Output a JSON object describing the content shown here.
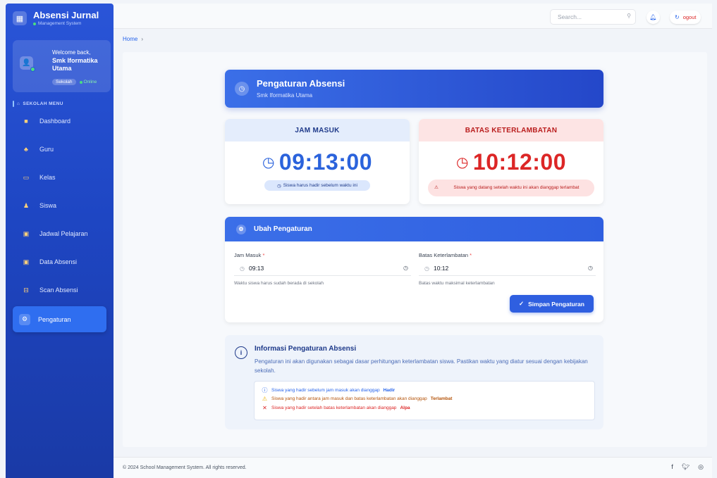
{
  "brand": {
    "title": "Absensi Jurnal",
    "subtitle": "Management System",
    "logo_icon": "building-icon"
  },
  "user": {
    "greeting": "Welcome back,",
    "name_line1": "Smk Iformatika",
    "name_line2": "Utama",
    "role": "Sekolah",
    "status": "Online"
  },
  "menu": {
    "heading": "SEKOLAH MENU",
    "items": [
      {
        "label": "Dashboard",
        "icon": "grid-icon"
      },
      {
        "label": "Guru",
        "icon": "users-icon"
      },
      {
        "label": "Kelas",
        "icon": "chalkboard-icon"
      },
      {
        "label": "Siswa",
        "icon": "student-icon"
      },
      {
        "label": "Jadwal Pelajaran",
        "icon": "calendar-icon"
      },
      {
        "label": "Data Absensi",
        "icon": "calendar-check-icon"
      },
      {
        "label": "Scan Absensi",
        "icon": "scan-icon"
      },
      {
        "label": "Pengaturan",
        "icon": "gear-icon",
        "active": true
      }
    ]
  },
  "header": {
    "search_placeholder": "Search...",
    "logout_label": "ogout"
  },
  "breadcrumb": {
    "home": "Home",
    "sep": "›"
  },
  "hero": {
    "title": "Pengaturan Absensi",
    "subtitle": "Smk Iformatika Utama"
  },
  "jam_masuk": {
    "heading": "JAM MASUK",
    "time": "09:13:00",
    "note": "Siswa harus hadir sebelum waktu ini"
  },
  "batas": {
    "heading": "BATAS KETERLAMBATAN",
    "time": "10:12:00",
    "note": "Siswa yang datang setelah waktu ini akan dianggap terlambat"
  },
  "form": {
    "title": "Ubah Pengaturan",
    "jam_masuk_label": "Jam Masuk",
    "jam_masuk_value": "09:13",
    "jam_masuk_help": "Waktu siswa harus sudah berada di sekolah",
    "batas_label": "Batas Keterlambatan",
    "batas_value": "10:12",
    "batas_help": "Batas waktu maksimal keterlambatan",
    "required_mark": "*",
    "save_label": "Simpan Pengaturan"
  },
  "info": {
    "title": "Informasi Pengaturan Absensi",
    "description": "Pengaturan ini akan digunakan sebagai dasar perhitungan keterlambatan siswa. Pastikan waktu yang diatur sesuai dengan kebijakan sekolah.",
    "rule1_text": "Siswa yang hadir sebelum jam masuk akan dianggap",
    "rule1_status": "Hadir",
    "rule2_text": "Siswa yang hadir antara jam masuk dan batas keterlambatan akan dianggap",
    "rule2_status": "Terlambat",
    "rule3_text": "Siswa yang hadir setelah batas keterlambatan akan dianggap",
    "rule3_status": "Alpa"
  },
  "footer": {
    "copyright": "© 2024 School Management System. All rights reserved."
  },
  "colors": {
    "primary": "#2f5fe0",
    "danger": "#dc2626",
    "warning": "#eab308"
  }
}
